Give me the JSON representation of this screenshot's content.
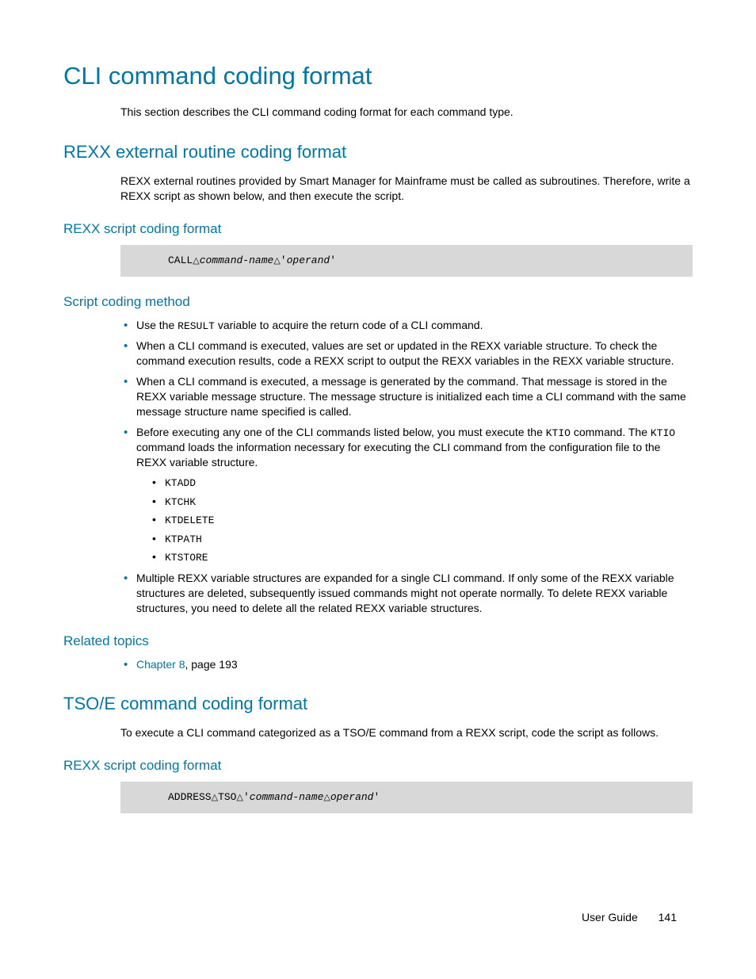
{
  "page": {
    "h1": "CLI command coding format",
    "intro": "This section describes the CLI command coding format for each command type.",
    "rexx": {
      "heading": "REXX external routine coding format",
      "intro": "REXX external routines provided by Smart Manager for Mainframe must be called as subroutines. Therefore, write a REXX script as shown below, and then execute the script.",
      "script_format_h": "REXX script coding format",
      "code_line1": "CALL△command-name△'operand'",
      "method_h": "Script coding method",
      "items": {
        "i0": "Use the RESULT variable to acquire the return code of a CLI command.",
        "i1": "When a CLI command is executed, values are set or updated in the REXX variable structure. To check the command execution results, code a REXX script to output the REXX variables in the REXX variable structure.",
        "i2": "When a CLI command is executed, a message is generated by the command. That message is stored in the REXX variable message structure. The message structure is initialized each time a CLI command with the same message structure name specified is called.",
        "i3": "Before executing any one of the CLI commands listed below, you must execute the KTIO command. The KTIO command loads the information necessary for executing the CLI command from the configuration file to the REXX variable structure.",
        "i3_sub": [
          "KTADD",
          "KTCHK",
          "KTDELETE",
          "KTPATH",
          "KTSTORE"
        ],
        "i4": "Multiple REXX variable structures are expanded for a single CLI command. If only some of the REXX variable structures are deleted, subsequently issued commands might not operate normally. To delete REXX variable structures, you need to delete all the related REXX variable structures."
      },
      "related_h": "Related topics",
      "related_link": "Chapter 8",
      "related_rest": ", page 193"
    },
    "tsoe": {
      "heading": "TSO/E command coding format",
      "intro": "To execute a CLI command categorized as a TSO/E command from a REXX script, code the script as follows.",
      "script_format_h": "REXX script coding format",
      "code_line1": "ADDRESS△TSO△'command-name△operand'"
    },
    "footer": {
      "label": "User Guide",
      "pagenum": "141"
    }
  }
}
